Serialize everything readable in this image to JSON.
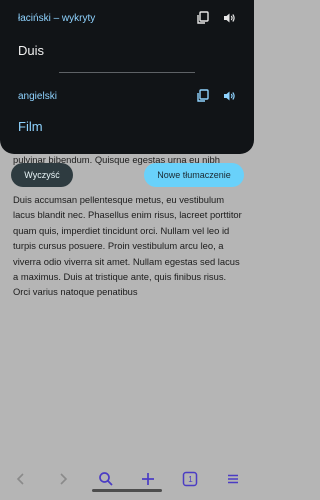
{
  "article": {
    "paragraph1": "pulvinar bibendum. Quisque egestas urna eu nibh",
    "paragraph2": "Duis accumsan pellentesque metus, eu vestibulum lacus blandit nec. Phasellus enim risus, lacreet porttitor quam quis, imperdiet tincidunt orci. Nullam vel leo id turpis cursus posuere. Proin vestibulum arcu leo, a viverra odio viverra sit amet. Nullam egestas sed lacus a maximus. Duis at tristique ante, quis finibus risus. Orci varius natoque penatibus"
  },
  "translator": {
    "source_language": "łaciński – wykryty",
    "source_text": "Duis",
    "target_language": "angielski",
    "target_text": "Film",
    "icons": [
      "copy-icon",
      "speaker-icon"
    ]
  },
  "actions": {
    "clear_label": "Wyczyść",
    "new_translation_label": "Nowe tłumaczenie"
  },
  "bottom_nav": {
    "tab_count": "1",
    "icons": [
      "back-icon",
      "forward-icon",
      "search-icon",
      "add-icon",
      "tabs-icon",
      "menu-icon"
    ]
  },
  "colors": {
    "card_background": "#111417",
    "accent_text": "#8fd3ff",
    "new_button": "#69d1fa",
    "clear_button": "#2e3b40",
    "nav_icon": "#4b3cc4"
  }
}
